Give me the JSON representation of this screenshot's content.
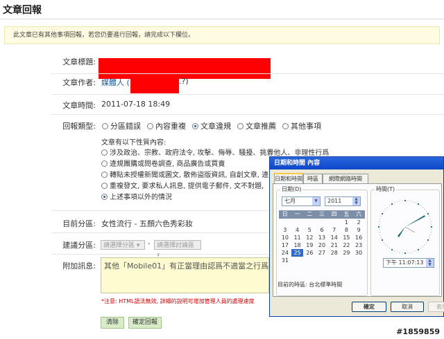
{
  "page": {
    "title": "文章回報",
    "notice": "此文章已有其他事項回報，若您仍要進行回報，請完成以下欄位。"
  },
  "article": {
    "title_label": "文章標題:",
    "author_label": "文章作者:",
    "author_value": "媒體人 (",
    "author_suffix": ".?)",
    "time_label": "文章時間:",
    "time_value": "2011-07-18 18:49"
  },
  "report": {
    "type_label": "回報類型:",
    "types": [
      {
        "label": "分區錯誤",
        "checked": false
      },
      {
        "label": "內容重複",
        "checked": false
      },
      {
        "label": "文章違規",
        "checked": true
      },
      {
        "label": "文章推薦",
        "checked": false
      },
      {
        "label": "其他事項",
        "checked": false
      }
    ],
    "nature_prompt": "文章有以下性質內容:",
    "natures": [
      {
        "label": "涉及政治、宗教、政府法令, 攻擊、侮辱、騷擾、挑釁他人、非理性行爲",
        "checked": false
      },
      {
        "label": "違規團購或問卷調查, 商品廣告或買賣",
        "checked": false
      },
      {
        "label": "轉貼未授權新聞或圖文, 散佈盜版資訊, 自創文章, 違",
        "checked": false
      },
      {
        "label": "重複發文, 要求私人訊息, 提供電子郵件, 文不對題,",
        "checked": false
      },
      {
        "label": "上述事項以外的情況",
        "checked": true
      }
    ]
  },
  "category": {
    "current_label": "目前分區:",
    "current_value": "女性流行 - 五顏六色秀彩妝",
    "suggest_label": "建議分區:",
    "select_area": "請選擇分區",
    "dash": "-",
    "select_board": "請選擇討論區"
  },
  "message": {
    "label": "附加訊息:",
    "value": "其他「Mobile01」有正當理由認爲不適當之行爲",
    "note": "*注意: HTML語法無效, 詳細的說明可增加管理人員的處理速度"
  },
  "buttons": {
    "clear": "清除",
    "submit": "確定回報"
  },
  "dialog": {
    "title": "日期和時間 內容",
    "tabs": [
      "日期和時間",
      "時區",
      "網際網路時間"
    ],
    "date_group": "日期(D)",
    "month": "七月",
    "year": "2011",
    "weekdays": [
      "日",
      "一",
      "二",
      "三",
      "四",
      "五",
      "六"
    ],
    "days": [
      "",
      "",
      "",
      "",
      "",
      "1",
      "2",
      "3",
      "4",
      "5",
      "6",
      "7",
      "8",
      "9",
      "10",
      "11",
      "12",
      "13",
      "14",
      "15",
      "16",
      "17",
      "18",
      "19",
      "20",
      "21",
      "22",
      "23",
      "24",
      "25",
      "26",
      "27",
      "28",
      "29",
      "30",
      "31"
    ],
    "selected_day": "25",
    "time_group": "時間(T)",
    "time_value": "下午  11:07:13",
    "timezone": "目前的時區: 台北標準時間",
    "ok": "確定",
    "cancel": "取消",
    "apply": "套用"
  },
  "watermark": "#1859859",
  "colors": {
    "redaction": "#ff0000",
    "dialog_title": "#0d46c8",
    "clock_hands": "#1a6e74"
  }
}
